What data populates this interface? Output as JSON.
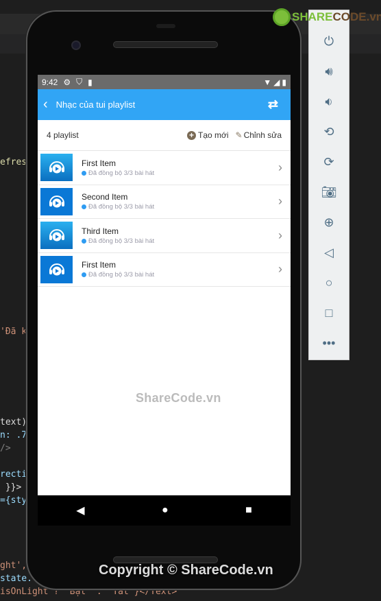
{
  "status_bar": {
    "time": "9:42"
  },
  "app_bar": {
    "title": "Nhạc của tui playlist"
  },
  "header": {
    "count": "4 playlist",
    "create_label": "Tạo mới",
    "edit_label": "Chỉnh sửa"
  },
  "playlists": [
    {
      "name": "First Item",
      "status": "Đã đồng bộ 3/3 bài hát"
    },
    {
      "name": "Second Item",
      "status": "Đã đồng bộ 3/3 bài hát"
    },
    {
      "name": "Third Item",
      "status": "Đã đồng bộ 3/3 bài hát"
    },
    {
      "name": "First Item",
      "status": "Đã đồng bộ 3/3 bài hát"
    }
  ],
  "watermark": "ShareCode.vn",
  "copyright": "Copyright © ShareCode.vn",
  "logo": {
    "text_a": "SHARE",
    "text_b": "CODE.vn"
  },
  "code_fragments": [
    "efres",
    "'Đã k",
    "text)",
    "n: .7",
    "/>",
    "recti",
    " }}>",
    "={sty",
    "ght',",
    "state.",
    "isOnLight ? 'Bật' : 'Tắt'}</Text>"
  ],
  "colors": {
    "accent": "#31a5f5",
    "status_dot": "#2f9cf2"
  }
}
